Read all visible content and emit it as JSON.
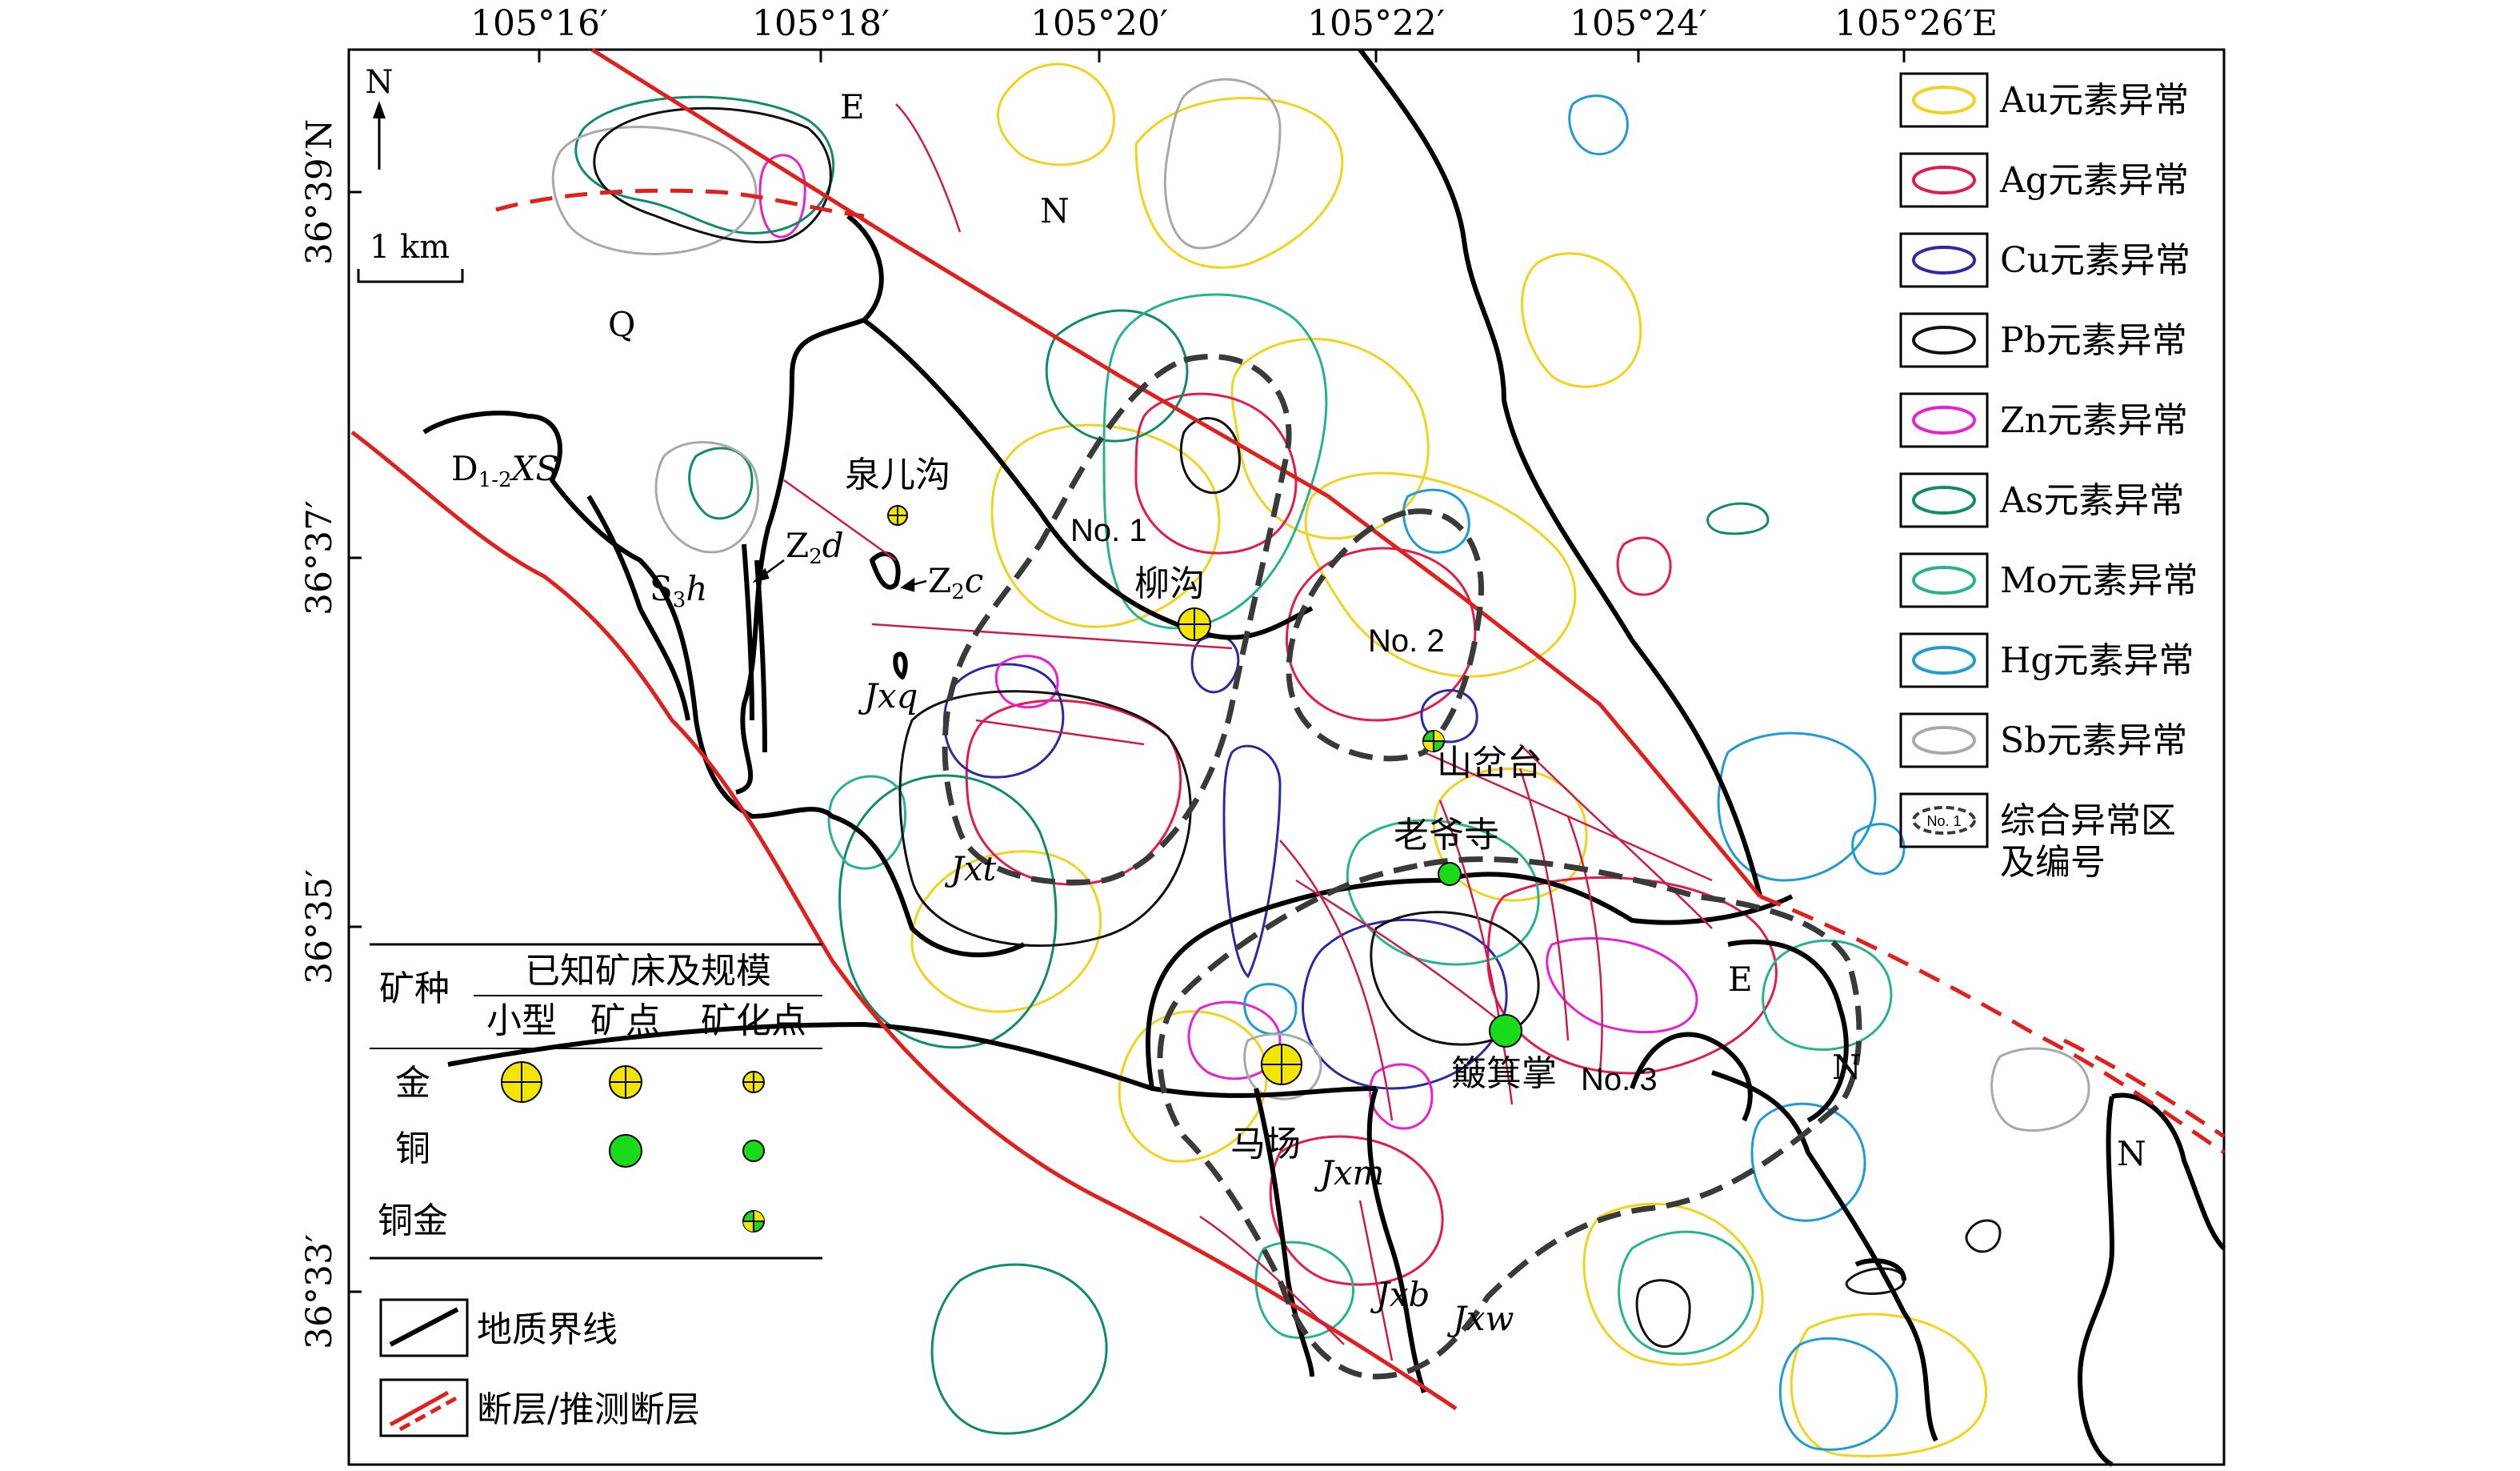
{
  "top_ticks": [
    "105°16′",
    "105°18′",
    "105°20′",
    "105°22′",
    "105°24′",
    "105°26′E"
  ],
  "left_ticks": [
    "36°39′N",
    "36°37′",
    "36°35′",
    "36°33′"
  ],
  "north_label": "N",
  "scale_label": "1 km",
  "unit_labels": {
    "Q": "Q",
    "E_top": "E",
    "N_top": "N",
    "D_main": "D",
    "D_sub": "1-2",
    "D_tail": "XS",
    "S_main": "S",
    "S_sub": "3",
    "S_tail": "h",
    "Zd_main": "Z",
    "Zd_sub": "2",
    "Zd_tail": "d",
    "Zc_main": "Z",
    "Zc_sub": "2",
    "Zc_tail": "c",
    "Jxq": "Jxq",
    "Jxt": "Jxt",
    "Jxm": "Jxm",
    "Jxb": "Jxb",
    "Jxw": "Jxw",
    "E_right": "E",
    "N_right1": "N",
    "N_right2": "N"
  },
  "zones": [
    {
      "label": "No. 1"
    },
    {
      "label": "No. 2"
    },
    {
      "label": "No. 3"
    }
  ],
  "places": [
    {
      "name": "泉儿沟"
    },
    {
      "name": "柳沟"
    },
    {
      "name": "山岔台"
    },
    {
      "name": "老爷寺"
    },
    {
      "name": "簸箕掌"
    },
    {
      "name": "马场"
    }
  ],
  "legend": [
    {
      "label": "Au元素异常",
      "color": "#f2d21b"
    },
    {
      "label": "Ag元素异常",
      "color": "#e6194b"
    },
    {
      "label": "Cu元素异常",
      "color": "#2b2aa6"
    },
    {
      "label": "Pb元素异常",
      "color": "#111111"
    },
    {
      "label": "Zn元素异常",
      "color": "#e81fd2"
    },
    {
      "label": "As元素异常",
      "color": "#0e8c6a"
    },
    {
      "label": "Mo元素异常",
      "color": "#25b38c"
    },
    {
      "label": "Hg元素异常",
      "color": "#1e9ad6"
    },
    {
      "label": "Sb元素异常",
      "color": "#a8a8a8"
    },
    {
      "label": "综合异常区",
      "label2": "及编号",
      "symbol_text": "No. 1"
    }
  ],
  "mineral_table": {
    "col_header": "矿种",
    "group_header": "已知矿床及规模",
    "sub_headers": [
      "小型",
      "矿点",
      "矿化点"
    ],
    "rows": [
      "金",
      "铜",
      "铜金"
    ]
  },
  "bottom_legend": [
    {
      "label": "地质界线"
    },
    {
      "label": "断层/推测断层"
    }
  ],
  "colors": {
    "gold": "#f2e600",
    "copper": "#1adb1a",
    "fault": "#e0201c",
    "boundary": "#000000"
  }
}
